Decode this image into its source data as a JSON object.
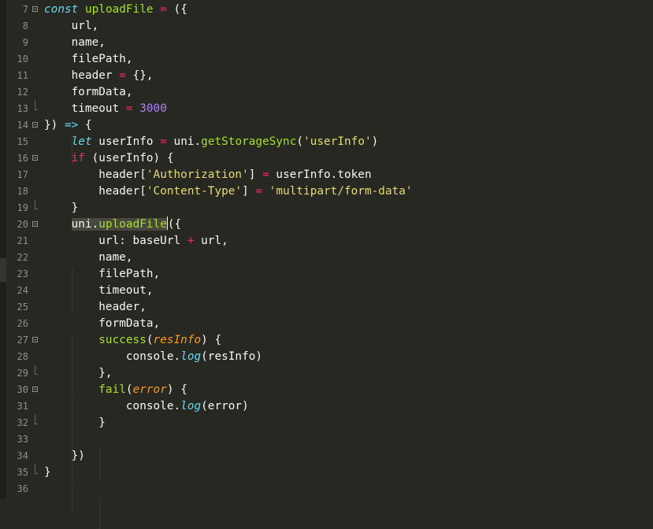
{
  "editor": {
    "language": "javascript",
    "theme_colors": {
      "background": "#272822",
      "foreground": "#f8f8f2",
      "keyword": "#f92672",
      "storage": "#66d9ef",
      "function": "#a6e22e",
      "string": "#e6db74",
      "number": "#ae81ff",
      "parameter": "#fd971f",
      "line_number": "#8f908a"
    },
    "lines": [
      {
        "n": "7",
        "tokens": [
          [
            "s",
            "const"
          ],
          [
            "p",
            " "
          ],
          [
            "f",
            "uploadFile"
          ],
          [
            "p",
            " "
          ],
          [
            "o",
            "="
          ],
          [
            "p",
            " ({"
          ]
        ]
      },
      {
        "n": "8",
        "tokens": [
          [
            "p",
            "    url,"
          ]
        ]
      },
      {
        "n": "9",
        "tokens": [
          [
            "p",
            "    name,"
          ]
        ]
      },
      {
        "n": "10",
        "tokens": [
          [
            "p",
            "    filePath,"
          ]
        ]
      },
      {
        "n": "11",
        "tokens": [
          [
            "p",
            "    header "
          ],
          [
            "o",
            "="
          ],
          [
            "p",
            " {},"
          ]
        ]
      },
      {
        "n": "12",
        "tokens": [
          [
            "p",
            "    formData,"
          ]
        ]
      },
      {
        "n": "13",
        "tokens": [
          [
            "p",
            "    timeout "
          ],
          [
            "o",
            "="
          ],
          [
            "p",
            " "
          ],
          [
            "num",
            "3000"
          ]
        ]
      },
      {
        "n": "14",
        "tokens": [
          [
            "p",
            "}) "
          ],
          [
            "s",
            "=>"
          ],
          [
            "p",
            " {"
          ]
        ]
      },
      {
        "n": "15",
        "tokens": [
          [
            "p",
            "    "
          ],
          [
            "s",
            "let"
          ],
          [
            "p",
            " userInfo "
          ],
          [
            "o",
            "="
          ],
          [
            "p",
            " uni."
          ],
          [
            "f",
            "getStorageSync"
          ],
          [
            "p",
            "("
          ],
          [
            "str",
            "'userInfo'"
          ],
          [
            "p",
            ")"
          ]
        ]
      },
      {
        "n": "16",
        "tokens": [
          [
            "p",
            "    "
          ],
          [
            "o",
            "if"
          ],
          [
            "p",
            " (userInfo) {"
          ]
        ]
      },
      {
        "n": "17",
        "tokens": [
          [
            "p",
            "        header["
          ],
          [
            "str",
            "'Authorization'"
          ],
          [
            "p",
            "] "
          ],
          [
            "o",
            "="
          ],
          [
            "p",
            " userInfo.token"
          ]
        ]
      },
      {
        "n": "18",
        "tokens": [
          [
            "p",
            "        header["
          ],
          [
            "str",
            "'Content-Type'"
          ],
          [
            "p",
            "] "
          ],
          [
            "o",
            "="
          ],
          [
            "p",
            " "
          ],
          [
            "str",
            "'multipart/form-data'"
          ]
        ]
      },
      {
        "n": "19",
        "tokens": [
          [
            "p",
            "    }"
          ]
        ]
      },
      {
        "n": "20",
        "tokens": [
          [
            "p",
            "    "
          ],
          [
            "sel",
            "uni."
          ],
          [
            "self",
            "uploadFile"
          ],
          [
            "cur",
            ""
          ],
          [
            "p",
            "({"
          ]
        ]
      },
      {
        "n": "21",
        "tokens": [
          [
            "p",
            "        url: baseUrl "
          ],
          [
            "o",
            "+"
          ],
          [
            "p",
            " url,"
          ]
        ]
      },
      {
        "n": "22",
        "tokens": [
          [
            "p",
            "        name,"
          ]
        ]
      },
      {
        "n": "23",
        "tokens": [
          [
            "p",
            "        filePath,"
          ]
        ]
      },
      {
        "n": "24",
        "tokens": [
          [
            "p",
            "        timeout,"
          ]
        ]
      },
      {
        "n": "25",
        "tokens": [
          [
            "p",
            "        header,"
          ]
        ]
      },
      {
        "n": "26",
        "tokens": [
          [
            "p",
            "        formData,"
          ]
        ]
      },
      {
        "n": "27",
        "tokens": [
          [
            "p",
            "        "
          ],
          [
            "f",
            "success"
          ],
          [
            "p",
            "("
          ],
          [
            "par",
            "resInfo"
          ],
          [
            "p",
            ") {"
          ]
        ]
      },
      {
        "n": "28",
        "tokens": [
          [
            "p",
            "            console."
          ],
          [
            "s",
            "log"
          ],
          [
            "p",
            "(resInfo)"
          ]
        ]
      },
      {
        "n": "29",
        "tokens": [
          [
            "p",
            "        },"
          ]
        ]
      },
      {
        "n": "30",
        "tokens": [
          [
            "p",
            "        "
          ],
          [
            "f",
            "fail"
          ],
          [
            "p",
            "("
          ],
          [
            "par",
            "error"
          ],
          [
            "p",
            ") {"
          ]
        ]
      },
      {
        "n": "31",
        "tokens": [
          [
            "p",
            "            console."
          ],
          [
            "s",
            "log"
          ],
          [
            "p",
            "(error)"
          ]
        ]
      },
      {
        "n": "32",
        "tokens": [
          [
            "p",
            "        }"
          ]
        ]
      },
      {
        "n": "33",
        "tokens": []
      },
      {
        "n": "34",
        "tokens": [
          [
            "p",
            "    })"
          ]
        ]
      },
      {
        "n": "35",
        "tokens": [
          [
            "p",
            "}"
          ]
        ]
      },
      {
        "n": "36",
        "tokens": []
      }
    ]
  }
}
